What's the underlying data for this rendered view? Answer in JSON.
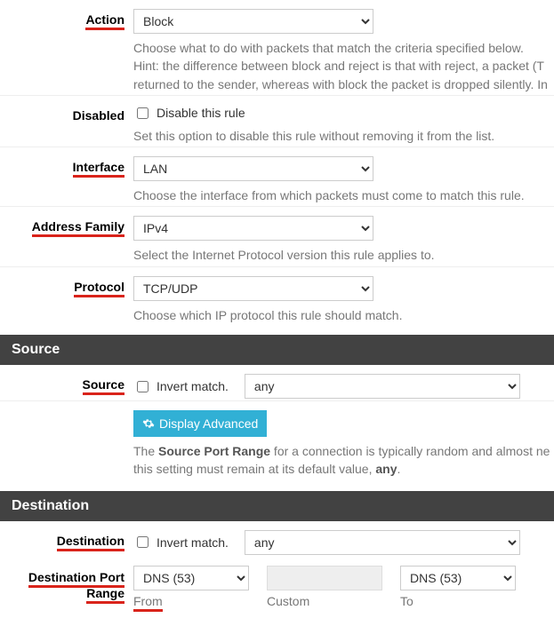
{
  "action": {
    "label": "Action",
    "value": "Block",
    "help": "Choose what to do with packets that match the criteria specified below.\nHint: the difference between block and reject is that with reject, a packet (T\nreturned to the sender, whereas with block the packet is dropped silently. In"
  },
  "disabled": {
    "label": "Disabled",
    "cb_label": "Disable this rule",
    "help": "Set this option to disable this rule without removing it from the list."
  },
  "interface": {
    "label": "Interface",
    "value": "LAN",
    "help": "Choose the interface from which packets must come to match this rule."
  },
  "addrfamily": {
    "label": "Address Family",
    "value": "IPv4",
    "help": "Select the Internet Protocol version this rule applies to."
  },
  "protocol": {
    "label": "Protocol",
    "value": "TCP/UDP",
    "help": "Choose which IP protocol this rule should match."
  },
  "sections": {
    "source": "Source",
    "destination": "Destination"
  },
  "source": {
    "label": "Source",
    "invert": "Invert match.",
    "value": "any",
    "adv_btn": "Display Advanced",
    "help_pre": "The ",
    "help_bold1": "Source Port Range",
    "help_mid": " for a connection is typically random and almost ne\nthis setting must remain at its default value, ",
    "help_bold2": "any",
    "help_post": "."
  },
  "destination": {
    "label": "Destination",
    "invert": "Invert match.",
    "value": "any"
  },
  "dport": {
    "label": "Destination Port Range",
    "from_value": "DNS (53)",
    "to_value": "DNS (53)",
    "from_sub": "From",
    "custom_sub": "Custom",
    "to_sub": "To"
  }
}
